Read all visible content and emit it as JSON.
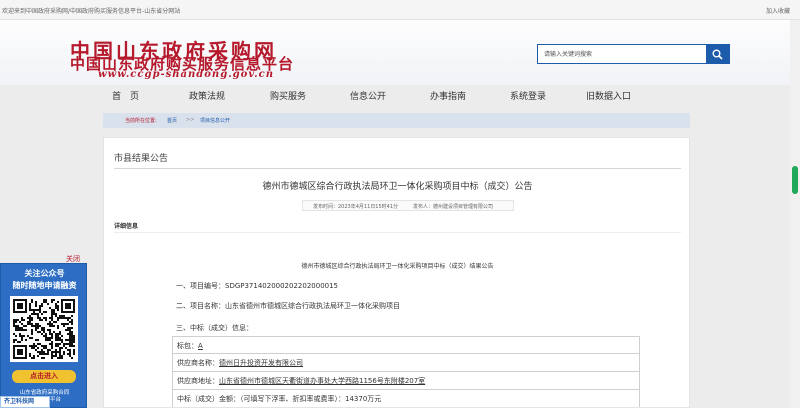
{
  "topbar": {
    "welcome": "欢迎来到中国政府采购网/中国政府购买服务信息平台-山东省分网站",
    "favorite": "加入收藏"
  },
  "logo": {
    "line1": "中国山东政府采购网",
    "line2": "中国山东政府购买服务信息平台",
    "domain": "www.ccgp-shandong.gov.cn"
  },
  "search": {
    "placeholder": "请输入关键词搜索",
    "icon": "search-icon"
  },
  "nav": {
    "items": [
      "首　页",
      "政策法规",
      "购买服务",
      "信息公开",
      "办事指南",
      "系统登录",
      "旧数据入口"
    ]
  },
  "breadcrumb": {
    "here": "当前所在位置:",
    "home": "首页",
    "sep": ">>",
    "current": "项目信息公开"
  },
  "section": {
    "title": "市县结果公告"
  },
  "article": {
    "title": "德州市德城区综合行政执法局环卫一体化采购项目中标（成交）公告",
    "date": "发布时间：2023年4月11日15时41分",
    "source": "发布人：德州建设项目管理有限公司",
    "detail_header": "详细信息",
    "inner_title": "德州市德城区综合行政执法局环卫一体化采购项目中标（成交）结果公告",
    "item1": "一、项目编号：SDGP371402000202202000015",
    "item2": "二、项目名称：山东省德州市德城区综合行政执法局环卫一体化采购项目",
    "item3": "三、中标（成交）信息："
  },
  "table": {
    "rows": [
      {
        "label": "标包：",
        "value": "A"
      },
      {
        "label": "供应商名称：",
        "value": "德州日升投资开发有限公司"
      },
      {
        "label": "供应商地址：",
        "value": "山东省德州市德城区天衢街道办事处大学西路1156号东附楼207室"
      },
      {
        "label": "中标（成交）金额：（可填写下浮率、折扣率或费率）：",
        "value": "14370万元"
      }
    ]
  },
  "floater": {
    "close": "关闭",
    "line1": "关注公众号",
    "line2": "随时随地申请融资",
    "button": "点击进入",
    "org1": "山东省政府采购合同",
    "org2": "融资服务平台"
  },
  "overlay": {
    "text": "齐卫科技网"
  },
  "colors": {
    "brand_red": "#b5192b",
    "brand_blue": "#1d5bab",
    "button_yellow": "#f0c230"
  }
}
